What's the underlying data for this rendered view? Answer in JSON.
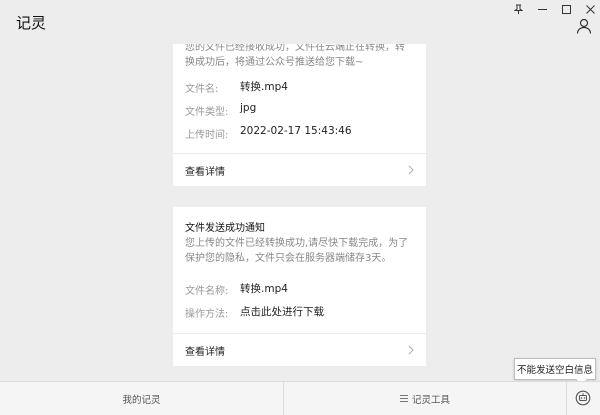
{
  "app": {
    "title": "记灵"
  },
  "window_controls": {
    "pin": "⊥",
    "minimize": "—",
    "maximize": "☐",
    "close": "✕"
  },
  "messages": [
    {
      "description": "您的文件已经接收成功，文件在云端正在转换，转换成功后，将通过公众号推送给您下载~",
      "fields": [
        {
          "label": "文件名:",
          "value": "转换.mp4"
        },
        {
          "label": "文件类型:",
          "value": "jpg"
        },
        {
          "label": "上传时间:",
          "value": "2022-02-17 15:43:46"
        }
      ],
      "details_label": "查看详情"
    },
    {
      "title": "文件发送成功通知",
      "description": "您上传的文件已经转换成功,请尽快下载完成，为了保护您的隐私，文件只会在服务器端储存3天。",
      "fields": [
        {
          "label": "文件名称:",
          "value": "转换.mp4"
        },
        {
          "label": "操作方法:",
          "value": "点击此处进行下载"
        }
      ],
      "details_label": "查看详情"
    }
  ],
  "tabs": [
    {
      "label": "我的记灵"
    },
    {
      "label": "记灵工具"
    }
  ],
  "tooltip": {
    "text": "不能发送空白信息"
  },
  "icons": [
    "pin-icon",
    "minimize-icon",
    "maximize-icon",
    "close-icon",
    "user-icon",
    "chevron-right-icon",
    "menu-icon",
    "bot-icon"
  ]
}
